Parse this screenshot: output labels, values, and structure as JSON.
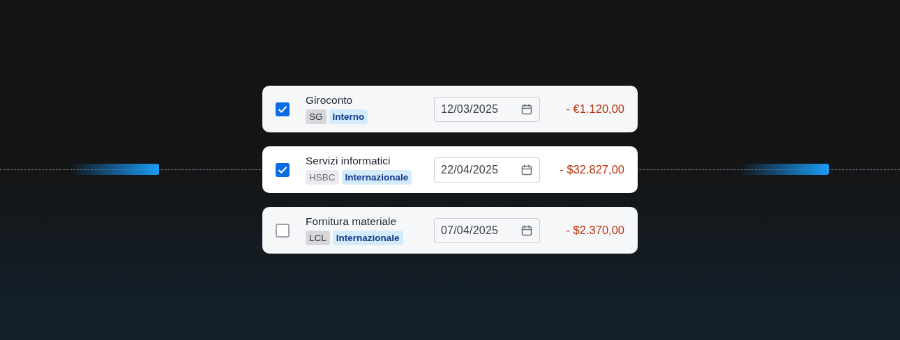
{
  "transactions": [
    {
      "title": "Giroconto",
      "checked": true,
      "highlighted": false,
      "tags": [
        {
          "label": "SG",
          "kind": "bank"
        },
        {
          "label": "Interno",
          "kind": "type"
        }
      ],
      "date": "12/03/2025",
      "amount": "- €1.120,00"
    },
    {
      "title": "Servizi informatici",
      "checked": true,
      "highlighted": true,
      "tags": [
        {
          "label": "HSBC",
          "kind": "bank"
        },
        {
          "label": "Internazionale",
          "kind": "type"
        }
      ],
      "date": "22/04/2025",
      "amount": "- $32.827,00"
    },
    {
      "title": "Fornitura materiale",
      "checked": false,
      "highlighted": false,
      "tags": [
        {
          "label": "LCL",
          "kind": "bank"
        },
        {
          "label": "Internazionale",
          "kind": "type"
        }
      ],
      "date": "07/04/2025",
      "amount": "- $2.370,00"
    }
  ]
}
